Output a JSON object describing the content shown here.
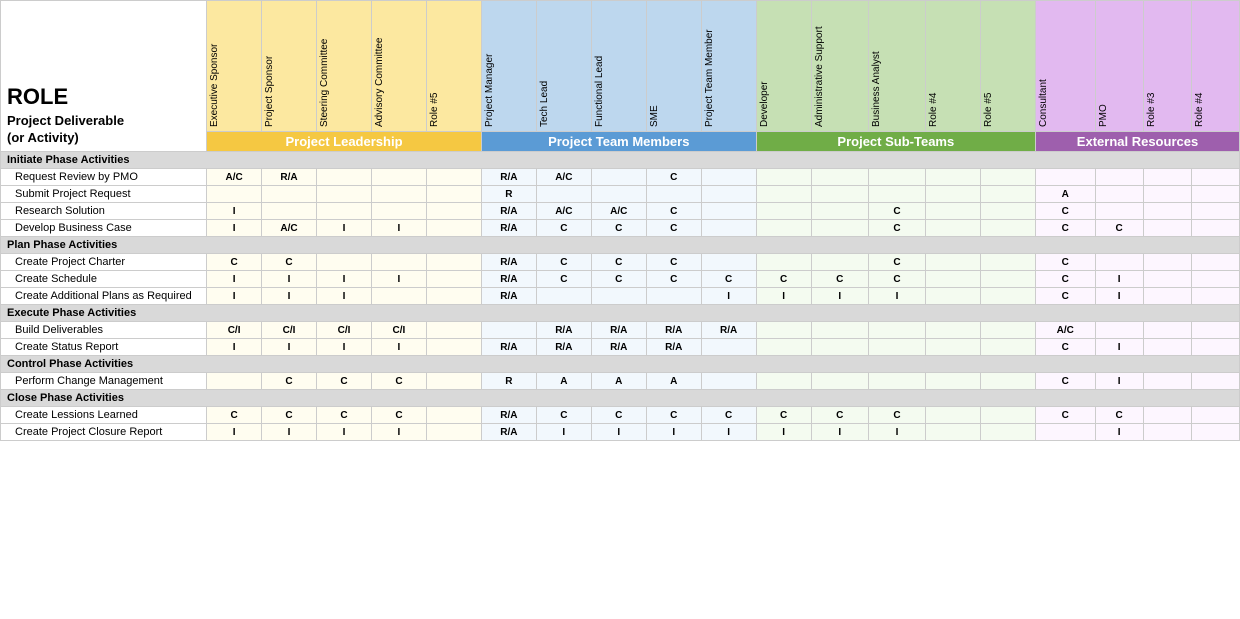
{
  "title": "ROLE",
  "deliverable_col_label": "Project Deliverable\n(or Activity)",
  "groups": [
    {
      "label": "Project Leadership",
      "class": "group-leadership",
      "col_class": "col-leadership",
      "span": 5
    },
    {
      "label": "Project Team Members",
      "class": "group-team",
      "col_class": "col-team",
      "span": 5
    },
    {
      "label": "Project Sub-Teams",
      "class": "group-subteams",
      "col_class": "col-subteams",
      "span": 6
    },
    {
      "label": "External Resources",
      "class": "group-external",
      "col_class": "col-external",
      "span": 4
    }
  ],
  "columns": [
    {
      "label": "Executive Sponsor",
      "group": "leadership"
    },
    {
      "label": "Project Sponsor",
      "group": "leadership"
    },
    {
      "label": "Steering Committee",
      "group": "leadership"
    },
    {
      "label": "Advisory Committee",
      "group": "leadership"
    },
    {
      "label": "Role #5",
      "group": "leadership"
    },
    {
      "label": "Project Manager",
      "group": "team"
    },
    {
      "label": "Tech Lead",
      "group": "team"
    },
    {
      "label": "Functional Lead",
      "group": "team"
    },
    {
      "label": "SME",
      "group": "team"
    },
    {
      "label": "Project Team Member",
      "group": "team"
    },
    {
      "label": "Developer",
      "group": "subteams"
    },
    {
      "label": "Administrative Support",
      "group": "subteams"
    },
    {
      "label": "Business Analyst",
      "group": "subteams"
    },
    {
      "label": "Role #4",
      "group": "subteams"
    },
    {
      "label": "Role #5",
      "group": "subteams"
    },
    {
      "label": "Consultant",
      "group": "external"
    },
    {
      "label": "PMO",
      "group": "external"
    },
    {
      "label": "Role #3",
      "group": "external"
    },
    {
      "label": "Role #4",
      "group": "external"
    }
  ],
  "rows": [
    {
      "type": "section",
      "label": "Initiate Phase Activities",
      "values": []
    },
    {
      "type": "data",
      "label": "Request Review by PMO",
      "values": [
        "A/C",
        "R/A",
        "",
        "",
        "",
        "R/A",
        "A/C",
        "",
        "C",
        "",
        "",
        "",
        "",
        "",
        "",
        "",
        "",
        "",
        ""
      ]
    },
    {
      "type": "data",
      "label": "Submit Project Request",
      "values": [
        "",
        "",
        "",
        "",
        "",
        "R",
        "",
        "",
        "",
        "",
        "",
        "",
        "",
        "",
        "",
        "A",
        "",
        "",
        ""
      ]
    },
    {
      "type": "data",
      "label": "Research Solution",
      "values": [
        "I",
        "",
        "",
        "",
        "",
        "R/A",
        "A/C",
        "A/C",
        "C",
        "",
        "",
        "",
        "C",
        "",
        "",
        "C",
        "",
        "",
        ""
      ]
    },
    {
      "type": "data",
      "label": "Develop Business Case",
      "values": [
        "I",
        "A/C",
        "I",
        "I",
        "",
        "R/A",
        "C",
        "C",
        "C",
        "",
        "",
        "",
        "C",
        "",
        "",
        "C",
        "C",
        "",
        ""
      ]
    },
    {
      "type": "section",
      "label": "Plan Phase Activities",
      "values": []
    },
    {
      "type": "data",
      "label": "Create Project Charter",
      "values": [
        "C",
        "C",
        "",
        "",
        "",
        "R/A",
        "C",
        "C",
        "C",
        "",
        "",
        "",
        "C",
        "",
        "",
        "C",
        "",
        "",
        ""
      ]
    },
    {
      "type": "data",
      "label": "Create Schedule",
      "values": [
        "I",
        "I",
        "I",
        "I",
        "",
        "R/A",
        "C",
        "C",
        "C",
        "C",
        "C",
        "C",
        "C",
        "",
        "",
        "C",
        "I",
        "",
        ""
      ]
    },
    {
      "type": "data",
      "label": "Create Additional Plans as Required",
      "values": [
        "I",
        "I",
        "I",
        "",
        "",
        "R/A",
        "",
        "",
        "",
        "I",
        "I",
        "I",
        "I",
        "",
        "",
        "C",
        "I",
        "",
        ""
      ]
    },
    {
      "type": "section",
      "label": "Execute Phase Activities",
      "values": []
    },
    {
      "type": "data",
      "label": "Build Deliverables",
      "values": [
        "C/I",
        "C/I",
        "C/I",
        "C/I",
        "",
        "",
        "R/A",
        "R/A",
        "R/A",
        "R/A",
        "",
        "",
        "",
        "",
        "",
        "A/C",
        "",
        "",
        ""
      ]
    },
    {
      "type": "data",
      "label": "Create Status Report",
      "values": [
        "I",
        "I",
        "I",
        "I",
        "",
        "R/A",
        "R/A",
        "R/A",
        "R/A",
        "",
        "",
        "",
        "",
        "",
        "",
        "C",
        "I",
        "",
        ""
      ]
    },
    {
      "type": "section",
      "label": "Control Phase Activities",
      "values": []
    },
    {
      "type": "data",
      "label": "Perform Change Management",
      "values": [
        "",
        "C",
        "C",
        "C",
        "",
        "R",
        "A",
        "A",
        "A",
        "",
        "",
        "",
        "",
        "",
        "",
        "C",
        "I",
        "",
        ""
      ]
    },
    {
      "type": "section",
      "label": "Close Phase Activities",
      "values": []
    },
    {
      "type": "data",
      "label": "Create Lessions Learned",
      "values": [
        "C",
        "C",
        "C",
        "C",
        "",
        "R/A",
        "C",
        "C",
        "C",
        "C",
        "C",
        "C",
        "C",
        "",
        "",
        "C",
        "C",
        "",
        ""
      ]
    },
    {
      "type": "data",
      "label": "Create Project Closure Report",
      "values": [
        "I",
        "I",
        "I",
        "I",
        "",
        "R/A",
        "I",
        "I",
        "I",
        "I",
        "I",
        "I",
        "I",
        "",
        "",
        "",
        "I",
        "",
        ""
      ]
    }
  ]
}
